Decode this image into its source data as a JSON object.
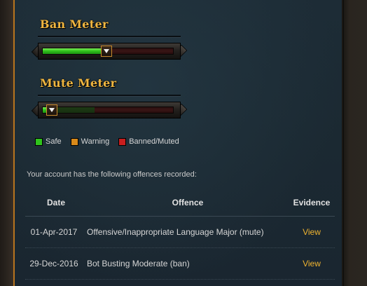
{
  "ban_meter": {
    "title": "Ban Meter",
    "level_fraction": 0.49
  },
  "mute_meter": {
    "title": "Mute Meter",
    "level_fraction": 0.07
  },
  "legend": [
    {
      "label": "Safe",
      "color": "#2fc41c"
    },
    {
      "label": "Warning",
      "color": "#d98a1a"
    },
    {
      "label": "Banned/Muted",
      "color": "#c81e1e"
    }
  ],
  "intro_text": "Your account has the following offences recorded:",
  "table": {
    "headers": {
      "date": "Date",
      "offence": "Offence",
      "evidence": "Evidence"
    },
    "rows": [
      {
        "date": "01-Apr-2017",
        "offence": "Offensive/Inappropriate Language Major (mute)",
        "evidence": "View"
      },
      {
        "date": "29-Dec-2016",
        "offence": "Bot Busting Moderate (ban)",
        "evidence": "View"
      }
    ]
  }
}
